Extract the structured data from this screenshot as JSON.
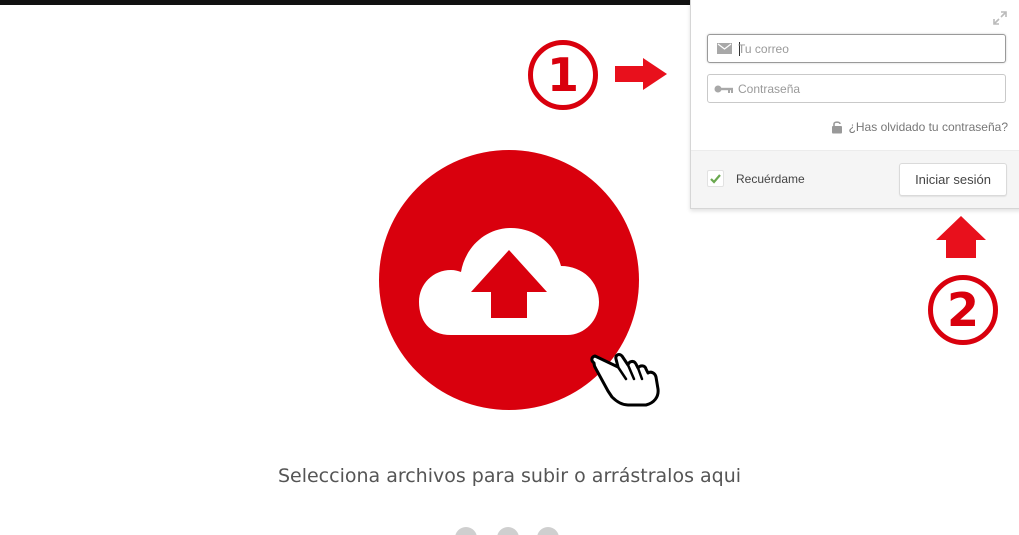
{
  "login": {
    "email_placeholder": "Tu correo",
    "password_placeholder": "Contraseña",
    "forgot_password": "¿Has olvidado tu contraseña?",
    "remember_me": "Recuérdame",
    "remember_checked": true,
    "submit_label": "Iniciar sesión"
  },
  "upload": {
    "prompt": "Selecciona archivos para subir o arrástralos aqui"
  },
  "annotations": {
    "step1": "1",
    "step2": "2"
  },
  "colors": {
    "accent": "#d9000d",
    "check": "#6aa84f"
  }
}
